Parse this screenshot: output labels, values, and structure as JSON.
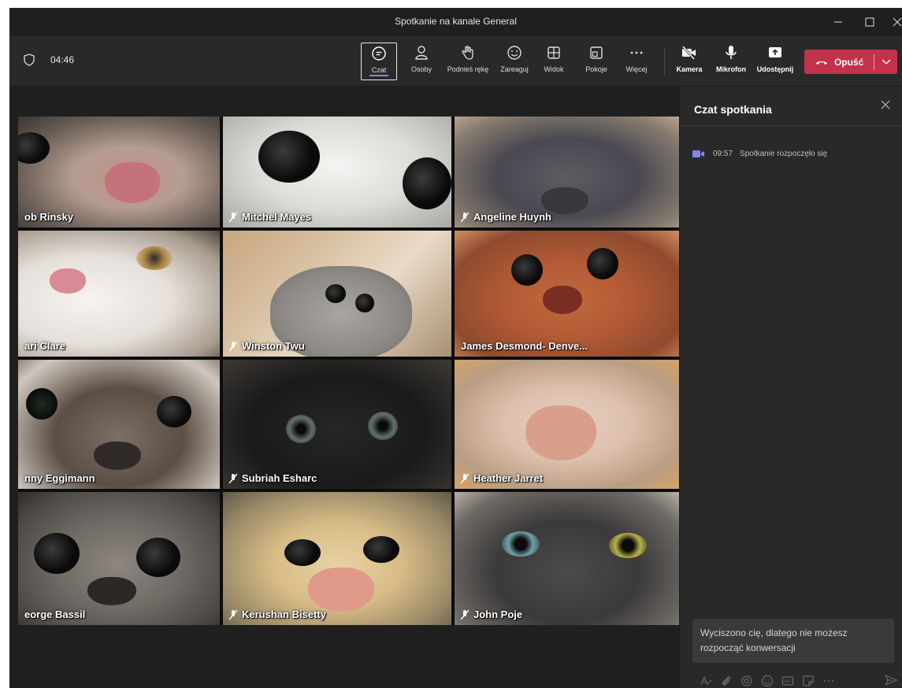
{
  "window": {
    "title": "Spotkanie na kanale General"
  },
  "toolbar": {
    "timer": "04:46",
    "buttons": [
      {
        "label": "Czat",
        "icon": "chat-icon"
      },
      {
        "label": "Osoby",
        "icon": "people-icon"
      },
      {
        "label": "Podnieś rękę",
        "icon": "raise-hand-icon"
      },
      {
        "label": "Zareaguj",
        "icon": "smile-icon"
      },
      {
        "label": "Widok",
        "icon": "grid-view-icon"
      },
      {
        "label": "Pokoje",
        "icon": "rooms-icon"
      },
      {
        "label": "Więcej",
        "icon": "more-icon"
      }
    ],
    "media": [
      {
        "label": "Kamera",
        "icon": "camera-off-icon"
      },
      {
        "label": "Mikrofon",
        "icon": "microphone-icon"
      },
      {
        "label": "Udostępnij",
        "icon": "share-icon"
      }
    ],
    "leave_label": "Opuść"
  },
  "participants": [
    {
      "name": "ob Rinsky"
    },
    {
      "name": "Mitchel Mayes"
    },
    {
      "name": "Angeline Huynh"
    },
    {
      "name": "ari Clare"
    },
    {
      "name": "Winston Twu"
    },
    {
      "name": "James Desmond- Denve..."
    },
    {
      "name": "nny Eggimann"
    },
    {
      "name": "Subriah Esharc"
    },
    {
      "name": "Heather Jarret"
    },
    {
      "name": "eorge Bassil"
    },
    {
      "name": "Kerushan Bisetty"
    },
    {
      "name": "John Poje"
    }
  ],
  "chat": {
    "title": "Czat spotkania",
    "event_time": "09:57",
    "event_text": "Spotkanie rozpoczęło się",
    "notice": "Wyciszono cię, dlatego nie możesz rozpocząć konwersacji",
    "accent": "#7f85f5"
  },
  "colors": {
    "leave": "#c4314b",
    "accent": "#7f85f5"
  }
}
